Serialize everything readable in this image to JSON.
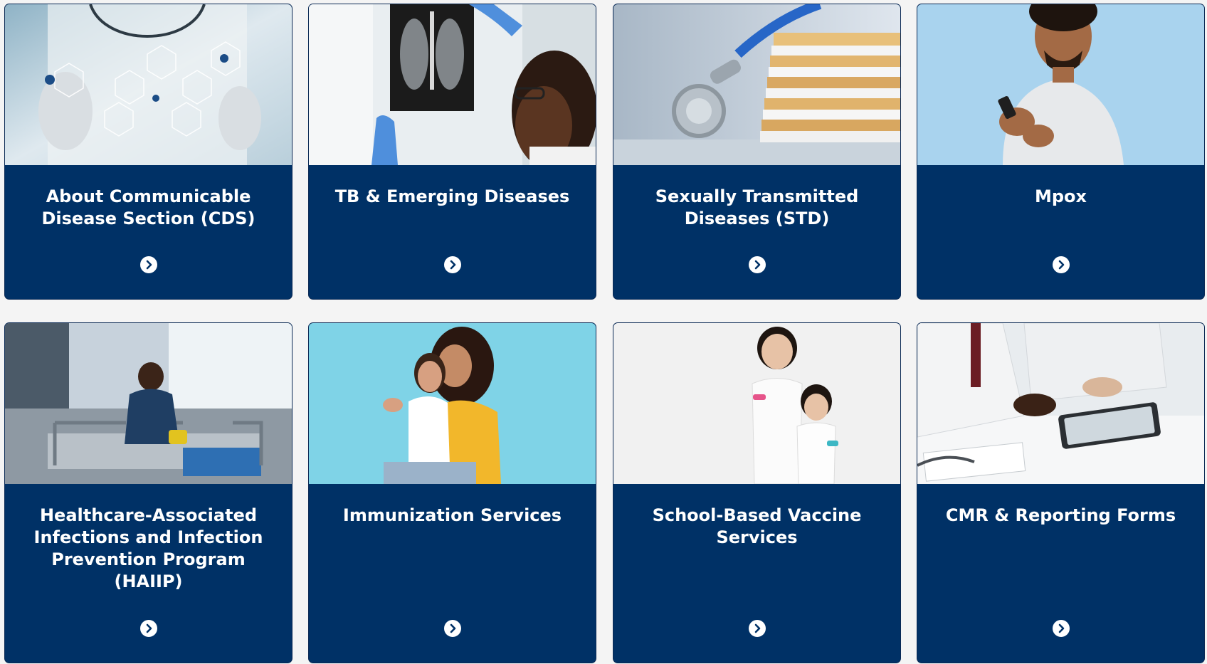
{
  "cards": [
    {
      "title": "About Communicable Disease Section (CDS)",
      "image": "doctor-touching-medical-icons-photo",
      "link_icon": "chevron-right-circle-icon"
    },
    {
      "title": "TB & Emerging Diseases",
      "image": "chest-xray-review-photo",
      "link_icon": "chevron-right-circle-icon"
    },
    {
      "title": "Sexually Transmitted Diseases (STD)",
      "image": "stethoscope-and-files-photo",
      "link_icon": "chevron-right-circle-icon"
    },
    {
      "title": "Mpox",
      "image": "smiling-man-with-phone-photo",
      "link_icon": "chevron-right-circle-icon"
    },
    {
      "title": "Healthcare-Associated Infections and Infection Prevention Program (HAIIP)",
      "image": "nurse-cleaning-hospital-bed-photo",
      "link_icon": "chevron-right-circle-icon"
    },
    {
      "title": "Immunization Services",
      "image": "mother-and-daughter-thumbs-up-photo",
      "link_icon": "chevron-right-circle-icon"
    },
    {
      "title": "School-Based Vaccine Services",
      "image": "two-girls-with-bandages-photo",
      "link_icon": "chevron-right-circle-icon"
    },
    {
      "title": "CMR & Reporting Forms",
      "image": "doctors-with-tablet-photo",
      "link_icon": "chevron-right-circle-icon"
    }
  ],
  "colors": {
    "card_background": "#003166",
    "page_background": "#f4f4f4",
    "title_text": "#ffffff"
  }
}
